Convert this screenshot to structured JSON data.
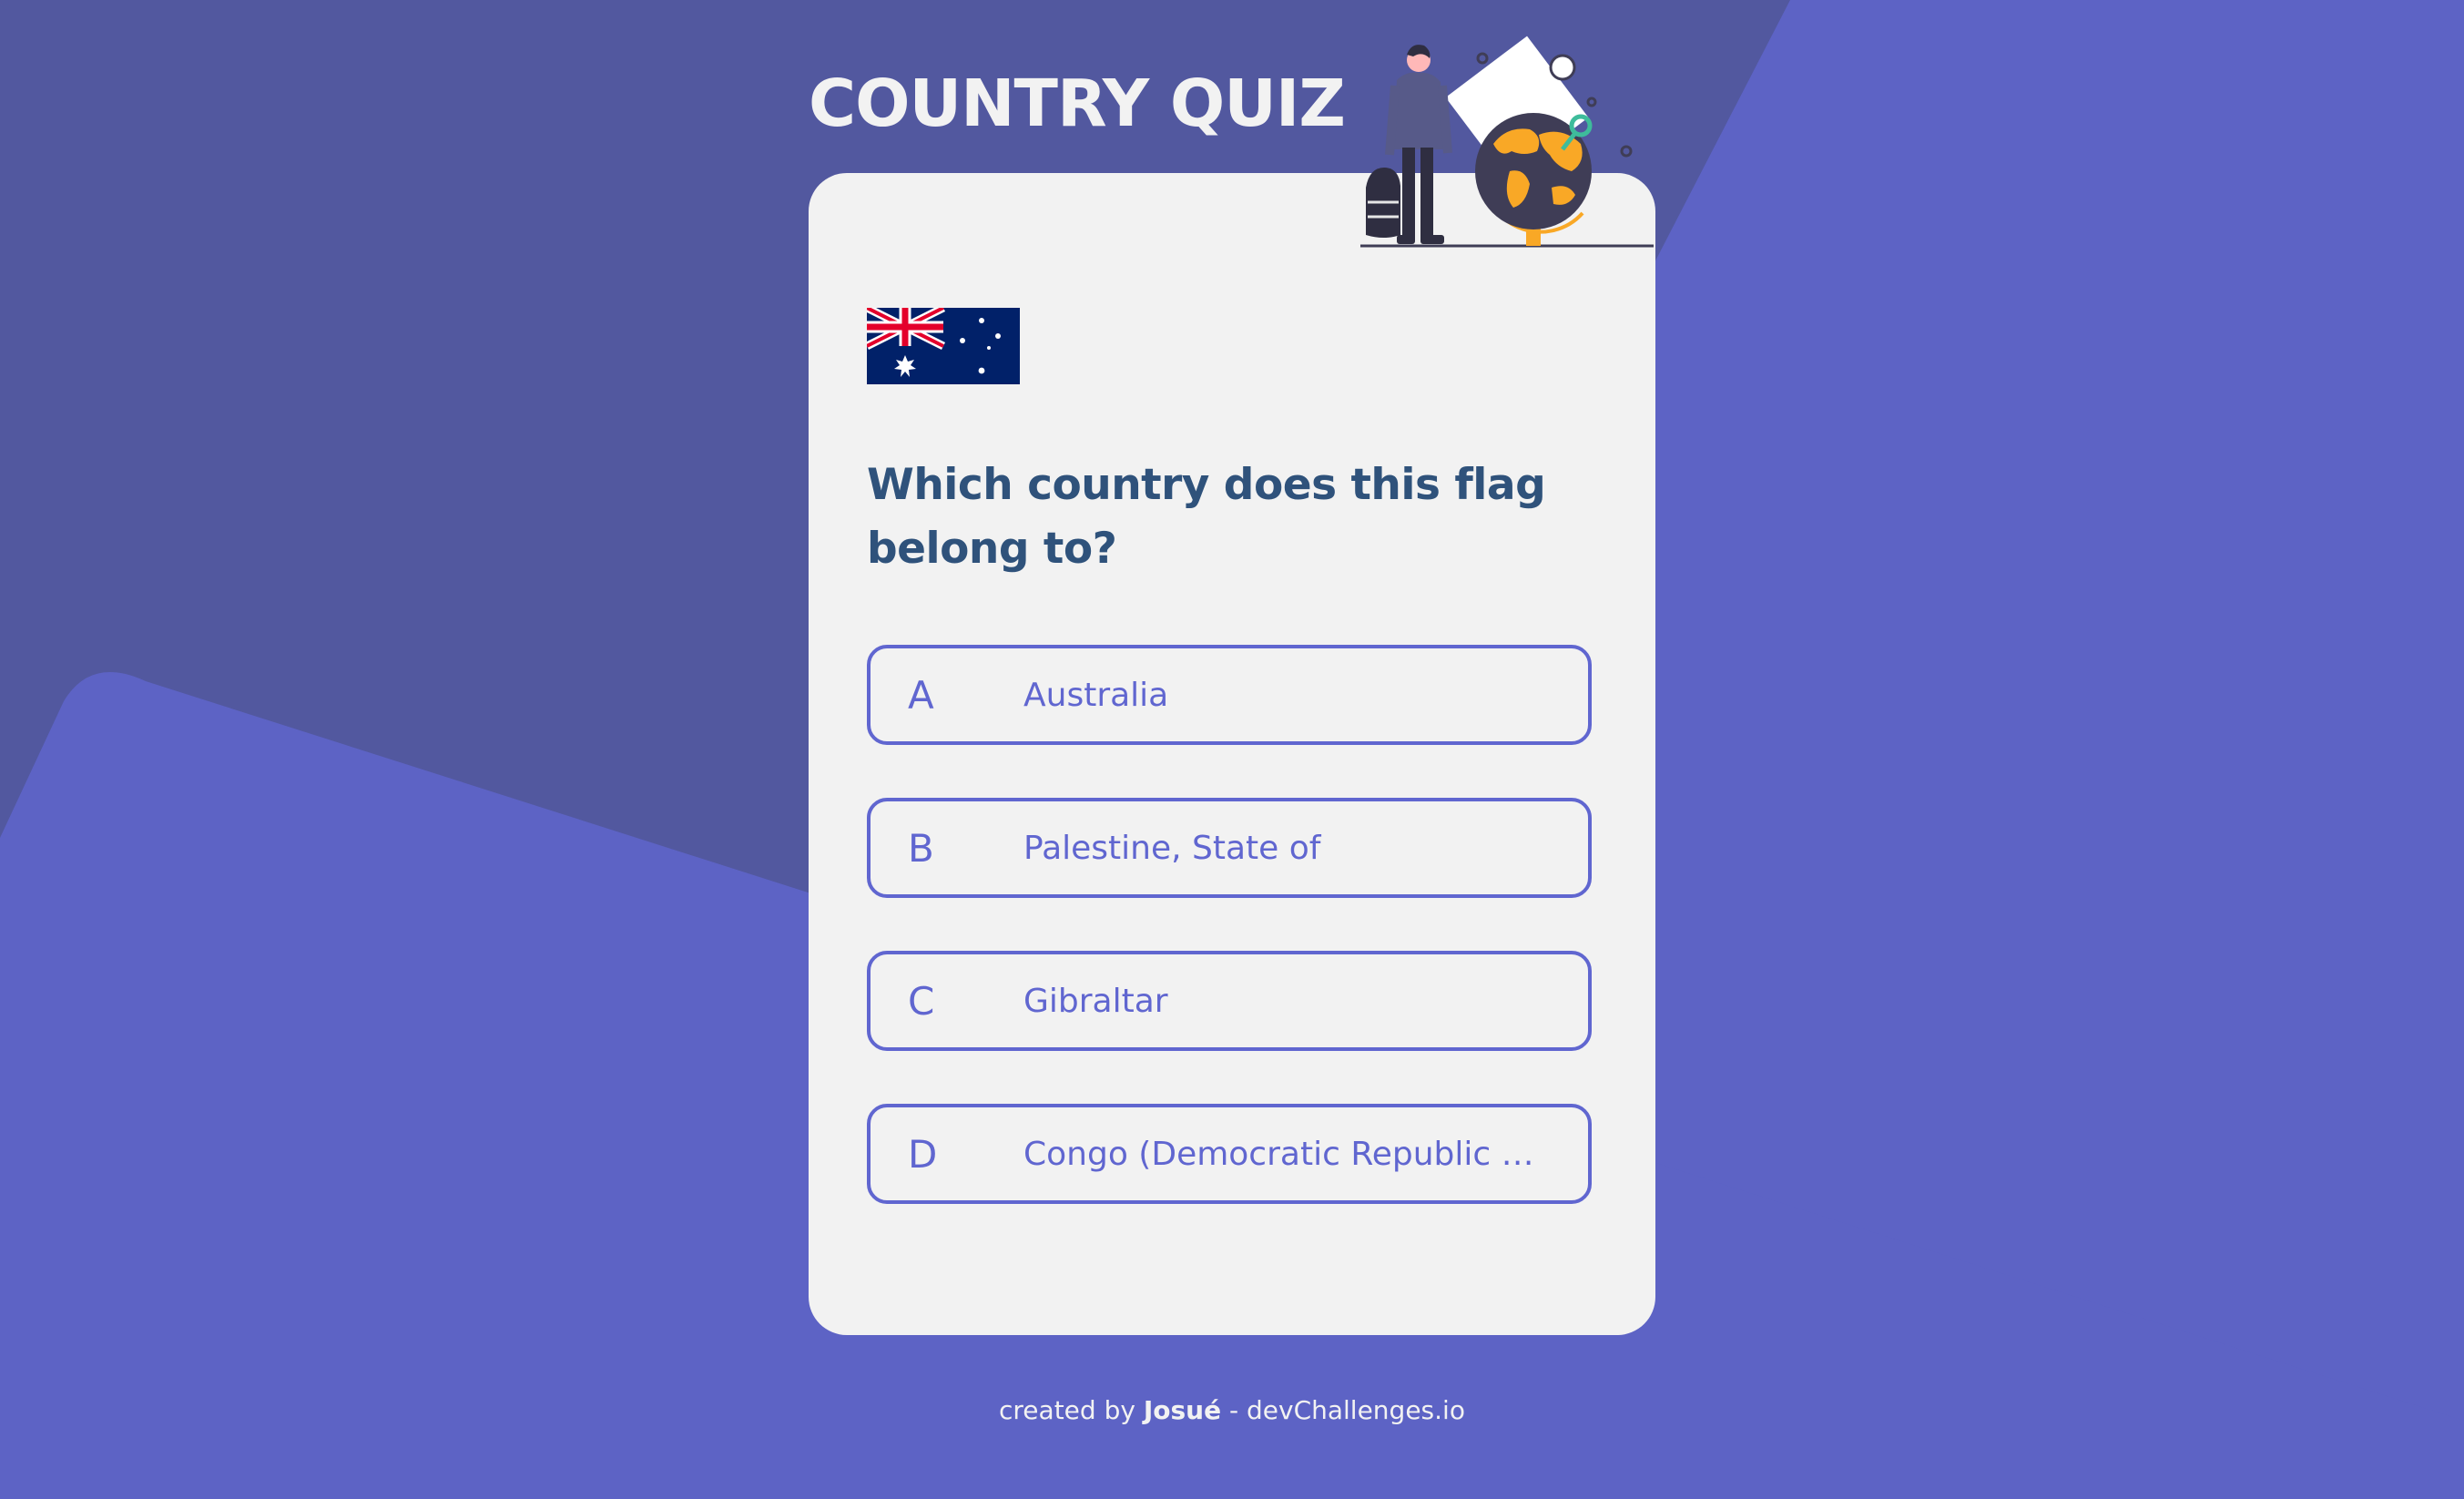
{
  "header": {
    "title": "COUNTRY QUIZ"
  },
  "quiz": {
    "flag_country": "Australia",
    "question": "Which country does this flag belong to?",
    "options": [
      {
        "letter": "A",
        "label": "Australia"
      },
      {
        "letter": "B",
        "label": "Palestine, State of"
      },
      {
        "letter": "C",
        "label": "Gibraltar"
      },
      {
        "letter": "D",
        "label": "Congo (Democratic Republic o…"
      }
    ]
  },
  "footer": {
    "prefix": "created by",
    "author": "Josué",
    "separator": "-",
    "site": "devChallenges.io"
  },
  "colors": {
    "background": "#52589f",
    "background_shape": "#5d63c5",
    "card": "#f2f2f2",
    "question_text": "#2f527b",
    "option_accent": "#6066d0",
    "illustration_accent": "#f9a826"
  },
  "icons": {
    "illustration": "traveler-globe-illustration",
    "flag": "australia-flag"
  }
}
